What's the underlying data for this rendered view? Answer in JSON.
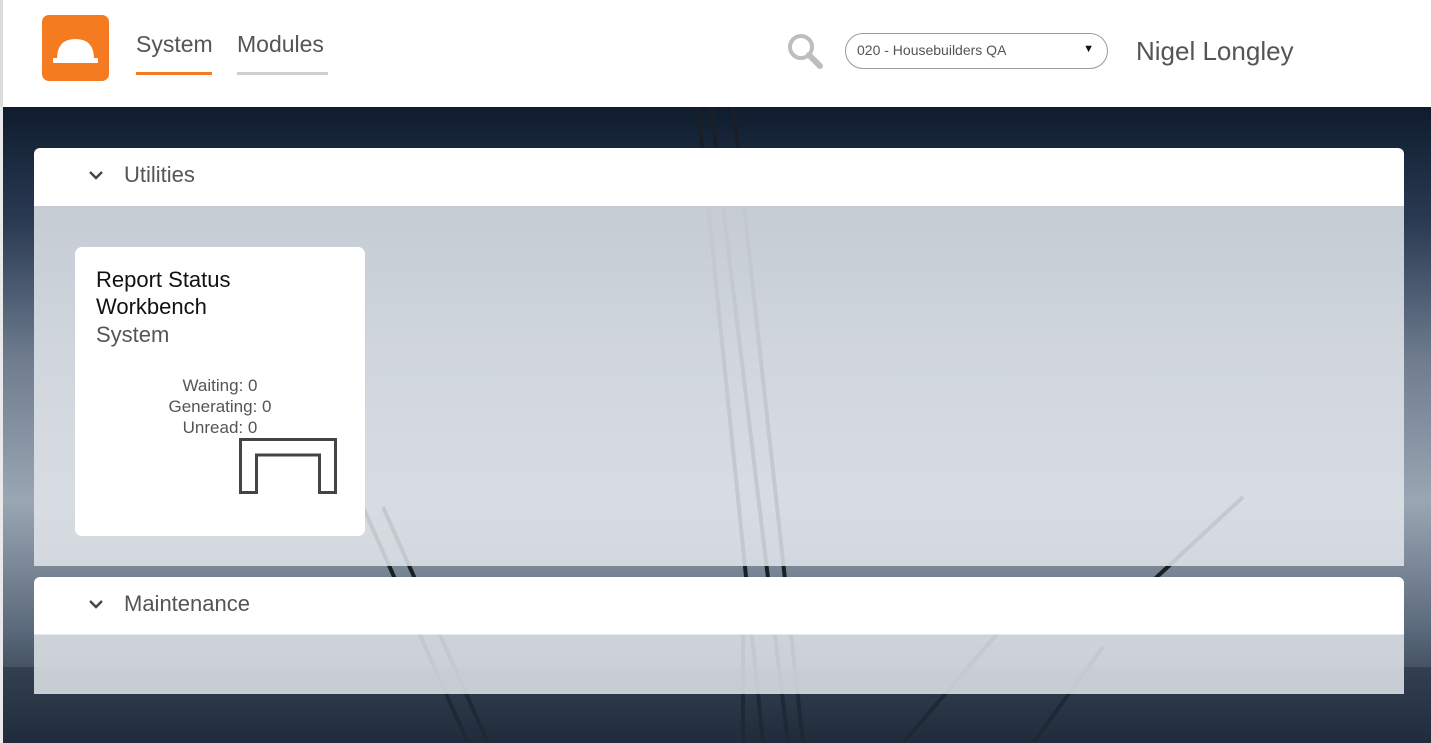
{
  "header": {
    "logo_icon": "hard-hat-icon",
    "brand_color": "#f47b20",
    "tabs": [
      {
        "label": "System",
        "active": true
      },
      {
        "label": "Modules",
        "active": false
      }
    ],
    "search_icon": "search-icon",
    "company_select": {
      "value": "020 - Housebuilders QA"
    },
    "user_name": "Nigel Longley"
  },
  "panels": [
    {
      "title": "Utilities",
      "expanded": true,
      "tiles": [
        {
          "title": "Report Status Workbench",
          "subtitle": "System",
          "stats": [
            "Waiting: 0",
            "Generating: 0",
            "Unread: 0"
          ],
          "icon": "workbench-icon"
        }
      ]
    },
    {
      "title": "Maintenance",
      "expanded": true,
      "tiles": []
    }
  ]
}
